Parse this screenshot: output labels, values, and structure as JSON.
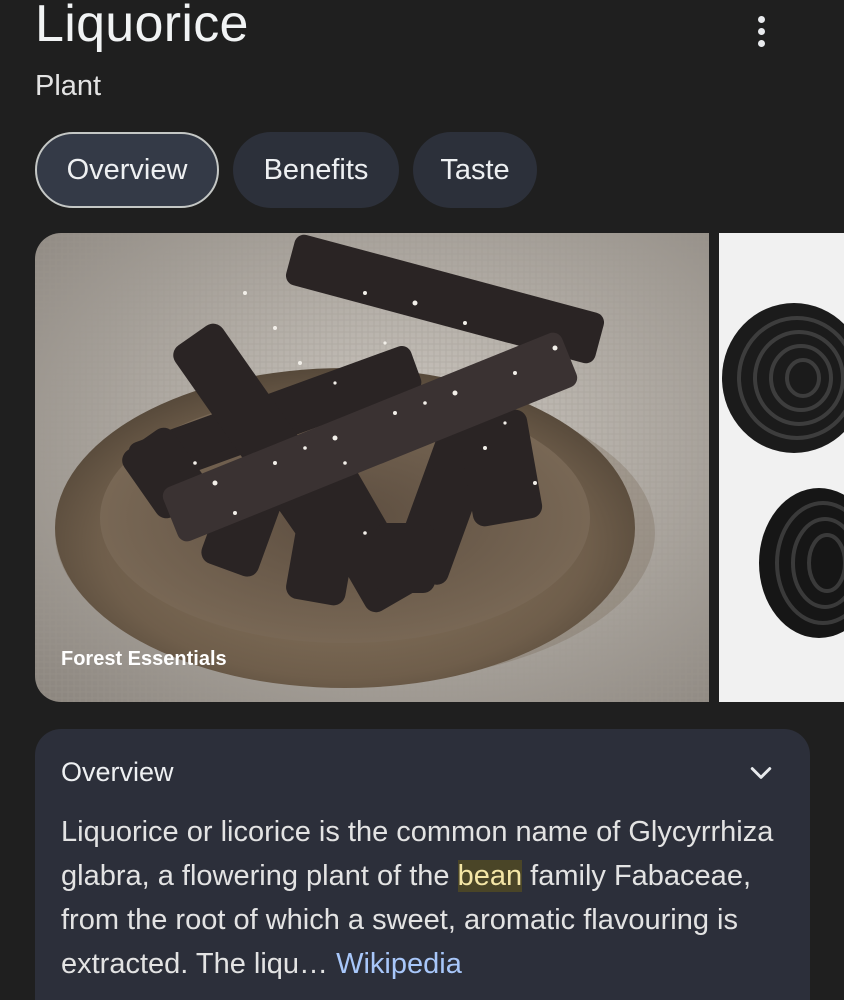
{
  "header": {
    "title": "Liquorice",
    "subtitle": "Plant",
    "more_icon": "more-vert-icon"
  },
  "tabs": [
    {
      "label": "Overview",
      "active": true
    },
    {
      "label": "Benefits",
      "active": false
    },
    {
      "label": "Taste",
      "active": false
    }
  ],
  "gallery": {
    "images": [
      {
        "source": "Forest Essentials",
        "depicts": "liquorice root sticks in wooden bowl"
      },
      {
        "source": "",
        "depicts": "black liquorice wheels"
      }
    ]
  },
  "overview": {
    "title": "Overview",
    "expand_icon": "chevron-down-icon",
    "text_before": "Liquorice or licorice is the common name of Glycyrrhiza glabra, a flowering plant of the",
    "highlight": "bean",
    "text_after": "family Fabaceae, from the root of which a sweet, aromatic flavouring is extracted. The liqu…",
    "source_link": "Wikipedia"
  },
  "colors": {
    "background": "#1f1f1f",
    "chip": "#2c303a",
    "card": "#2c2f3a",
    "link": "#a8c7fa",
    "highlight": "#4a4527"
  }
}
